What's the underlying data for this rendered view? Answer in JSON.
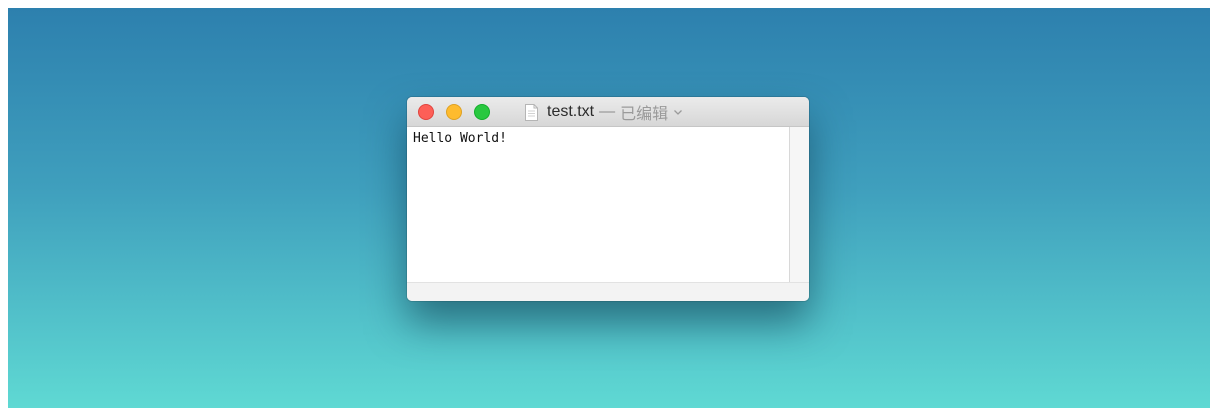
{
  "window": {
    "filename": "test.txt",
    "separator": "—",
    "status": "已编辑"
  },
  "editor": {
    "content": "Hello World!"
  },
  "icons": {
    "close": "close-icon",
    "minimize": "minimize-icon",
    "maximize": "maximize-icon",
    "document": "document-icon",
    "menu": "chevron-down-icon"
  },
  "colors": {
    "close": "#fd5f57",
    "minimize": "#febb2e",
    "maximize": "#29c840",
    "desktop_top": "#2d80ae",
    "desktop_bottom": "#5fd9d3"
  }
}
